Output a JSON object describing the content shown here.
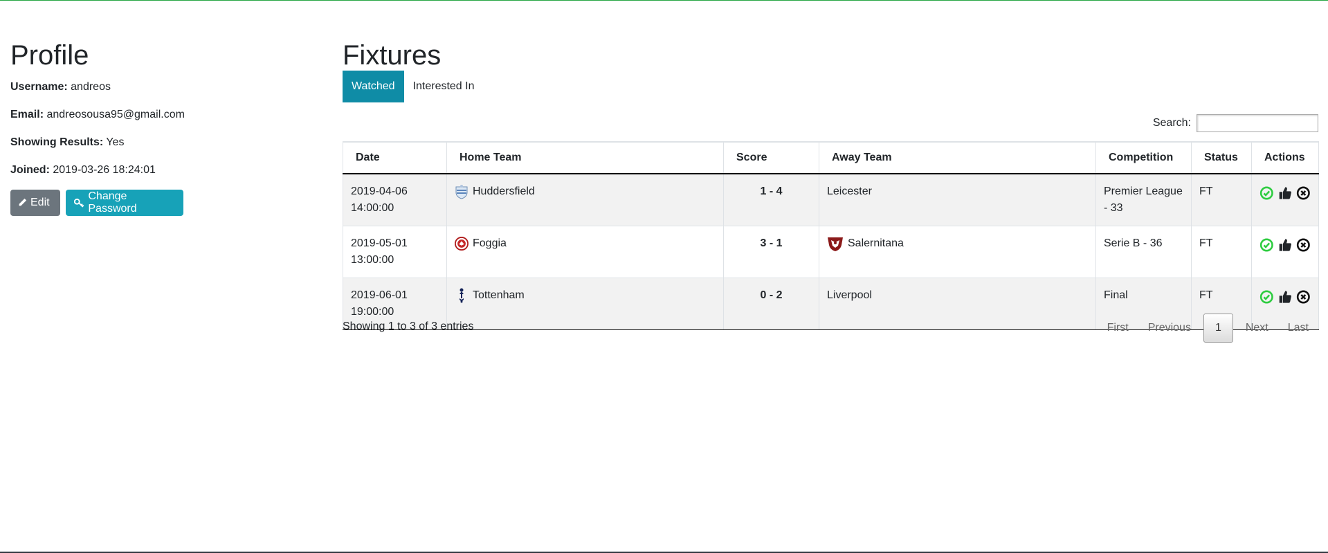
{
  "profile": {
    "title": "Profile",
    "username_label": "Username:",
    "username": "andreos",
    "email_label": "Email:",
    "email": "andreosousa95@gmail.com",
    "results_label": "Showing Results:",
    "results": "Yes",
    "joined_label": "Joined:",
    "joined": "2019-03-26 18:24:01",
    "edit_label": "Edit",
    "change_password_label": "Change Password"
  },
  "fixtures": {
    "title": "Fixtures",
    "tabs": [
      {
        "label": "Watched",
        "active": true
      },
      {
        "label": "Interested In",
        "active": false
      }
    ],
    "search_label": "Search:",
    "search_value": "",
    "columns": [
      "Date",
      "Home Team",
      "Score",
      "Away Team",
      "Competition",
      "Status",
      "Actions"
    ],
    "rows": [
      {
        "date": "2019-04-06",
        "time": "14:00:00",
        "home": "Huddersfield",
        "home_crest": "huddersfield-crest",
        "score": "1 - 4",
        "away": "Leicester",
        "away_crest": "",
        "competition": "Premier League - 33",
        "status": "FT"
      },
      {
        "date": "2019-05-01",
        "time": "13:00:00",
        "home": "Foggia",
        "home_crest": "foggia-crest",
        "score": "3 - 1",
        "away": "Salernitana",
        "away_crest": "salernitana-crest",
        "competition": "Serie B - 36",
        "status": "FT"
      },
      {
        "date": "2019-06-01",
        "time": "19:00:00",
        "home": "Tottenham",
        "home_crest": "tottenham-crest",
        "score": "0 - 2",
        "away": "Liverpool",
        "away_crest": "",
        "competition": "Final",
        "status": "FT"
      }
    ],
    "action_icons": [
      "check-circle-icon",
      "thumbs-up-icon",
      "times-circle-icon"
    ],
    "info": "Showing 1 to 3 of 3 entries",
    "pagination": {
      "first": "First",
      "previous": "Previous",
      "current": "1",
      "next": "Next",
      "last": "Last"
    }
  },
  "colors": {
    "tab_active": "#0f8ca6",
    "edit_button": "#6c757d",
    "password_button": "#17a2b8",
    "check_icon": "#2ecc40",
    "row_stripe": "#f2f2f2"
  }
}
